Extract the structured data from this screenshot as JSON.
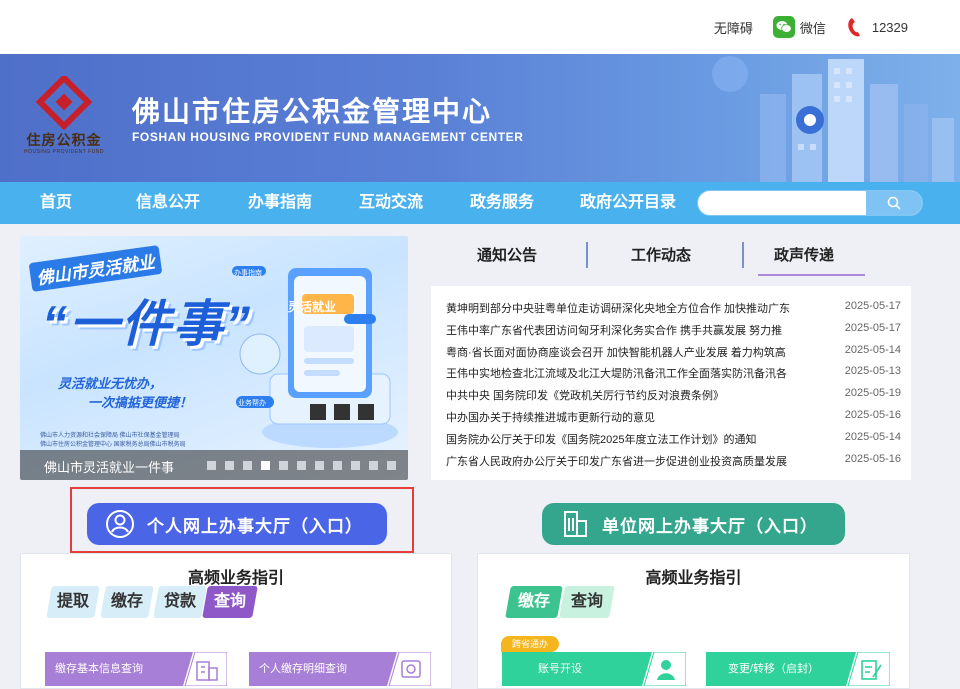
{
  "topbar": {
    "accessibility": "无障碍",
    "wechat": "微信",
    "hotline": "12329"
  },
  "header": {
    "logo_text": "住房公积金",
    "logo_sub": "HOUSING PROVIDENT FUND",
    "title_cn": "佛山市住房公积金管理中心",
    "title_en": "FOSHAN HOUSING PROVIDENT FUND  MANAGEMENT CENTER"
  },
  "nav": {
    "items": [
      "首页",
      "信息公开",
      "办事指南",
      "互动交流",
      "政务服务",
      "政府公开目录"
    ],
    "search_placeholder": ""
  },
  "hero": {
    "badge": "佛山市灵活就业",
    "headline": "“一件事”",
    "sub1": "灵活就业无忧办，",
    "sub2": "一次搞掂更便捷！",
    "org1": "佛山市人力资源和社会保障局   佛山市社保基金管理局",
    "org2": "佛山市住房公积金管理中心  国家税务总局佛山市税务局",
    "card_label": "灵活就业",
    "tag1": "办事指南",
    "tag2": "业务帮办",
    "caption": "佛山市灵活就业一件事",
    "slide_count": 11,
    "active_slide": 3
  },
  "news": {
    "tabs": [
      "通知公告",
      "工作动态",
      "政声传递"
    ],
    "active_tab": 2,
    "items": [
      {
        "title": "黄坤明到部分中央驻粤单位走访调研深化央地全方位合作 加快推动广东",
        "date": "2025-05-17"
      },
      {
        "title": "王伟中率广东省代表团访问匈牙利深化务实合作 携手共赢发展 努力推",
        "date": "2025-05-17"
      },
      {
        "title": "粤商·省长面对面协商座谈会召开 加快智能机器人产业发展 着力构筑高",
        "date": "2025-05-14"
      },
      {
        "title": "王伟中实地检查北江流域及北江大堤防汛备汛工作全面落实防汛备汛各",
        "date": "2025-05-13"
      },
      {
        "title": "中共中央 国务院印发《党政机关厉行节约反对浪费条例》",
        "date": "2025-05-19"
      },
      {
        "title": "中办国办关于持续推进城市更新行动的意见",
        "date": "2025-05-16"
      },
      {
        "title": "国务院办公厅关于印发《国务院2025年度立法工作计划》的通知",
        "date": "2025-05-14"
      },
      {
        "title": "广东省人民政府办公厅关于印发广东省进一步促进创业投资高质量发展",
        "date": "2025-05-16"
      }
    ]
  },
  "portals": {
    "personal": "个人网上办事大厅（入口）",
    "unit": "单位网上办事大厅（入口）"
  },
  "personal_card": {
    "title": "高频业务指引",
    "pills": [
      "提取",
      "缴存",
      "贷款",
      "查询"
    ],
    "active_pill": 3,
    "services": [
      "缴存基本信息查询",
      "个人缴存明细查询"
    ]
  },
  "unit_card": {
    "title": "高频业务指引",
    "pills": [
      "缴存",
      "查询"
    ],
    "active_pill": 0,
    "tag": "跨省通办",
    "services": [
      "账号开设",
      "变更/转移（启封）"
    ]
  },
  "colors": {
    "nav": "#4ab1ef",
    "banner": "#5a80d6",
    "personal_btn": "#4a65e6",
    "unit_btn": "#33a68d",
    "highlight_box": "#e53c3c",
    "purple": "#8e58c8",
    "green": "#3cc390"
  }
}
